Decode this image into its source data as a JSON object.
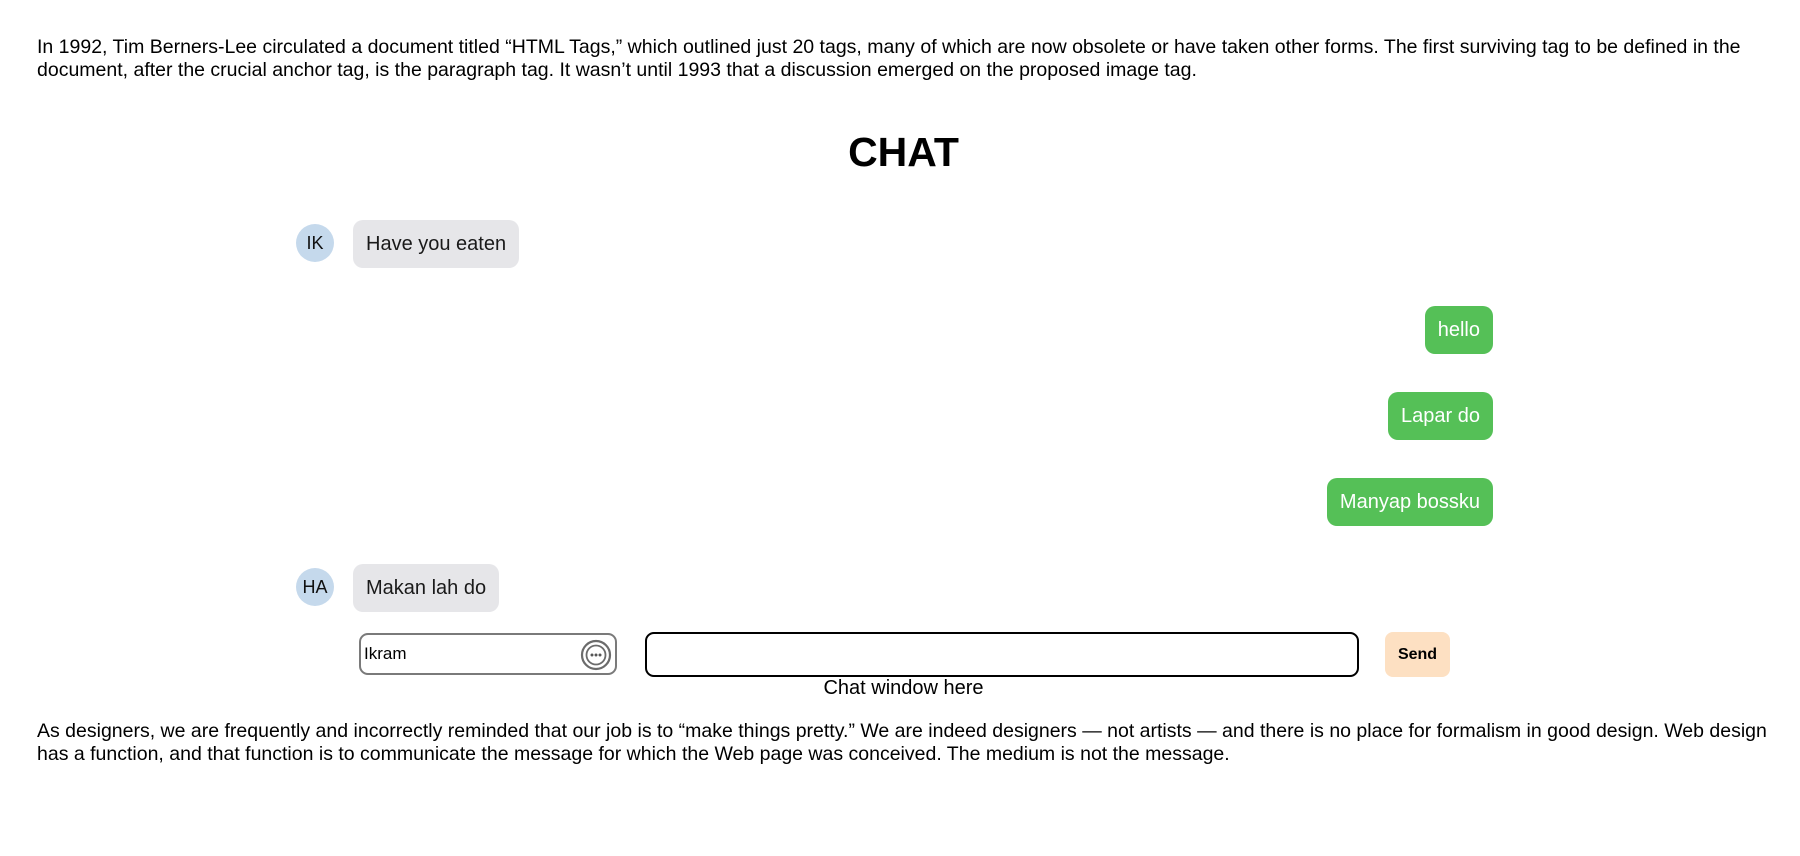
{
  "intro_text": "In 1992, Tim Berners-Lee circulated a document titled “HTML Tags,” which outlined just 20 tags, many of which are now obsolete or have taken other forms. The first surviving tag to be defined in the document, after the crucial anchor tag, is the paragraph tag. It wasn’t until 1993 that a discussion emerged on the proposed image tag.",
  "chat": {
    "title": "CHAT",
    "messages": [
      {
        "direction": "incoming",
        "avatar": "IK",
        "text": "Have you eaten"
      },
      {
        "direction": "outgoing",
        "text": "hello"
      },
      {
        "direction": "outgoing",
        "text": "Lapar do"
      },
      {
        "direction": "outgoing",
        "text": "Manyap bossku"
      },
      {
        "direction": "incoming",
        "avatar": "HA",
        "text": "Makan lah do"
      }
    ],
    "name_input_value": "Ikram",
    "name_input_icon": "more-icon",
    "message_input_value": "",
    "send_label": "Send",
    "caption": "Chat window here"
  },
  "outro_text": "As designers, we are frequently and incorrectly reminded that our job is to “make things pretty.” We are indeed designers — not artists — and there is no place for formalism in good design. Web design has a function, and that function is to communicate the message for which the Web page was conceived. The medium is not the message.",
  "colors": {
    "incoming_bubble": "#e6e6e9",
    "outgoing_bubble": "#55c057",
    "avatar_bg": "#c5d9ec",
    "send_button": "#fde0c2"
  }
}
